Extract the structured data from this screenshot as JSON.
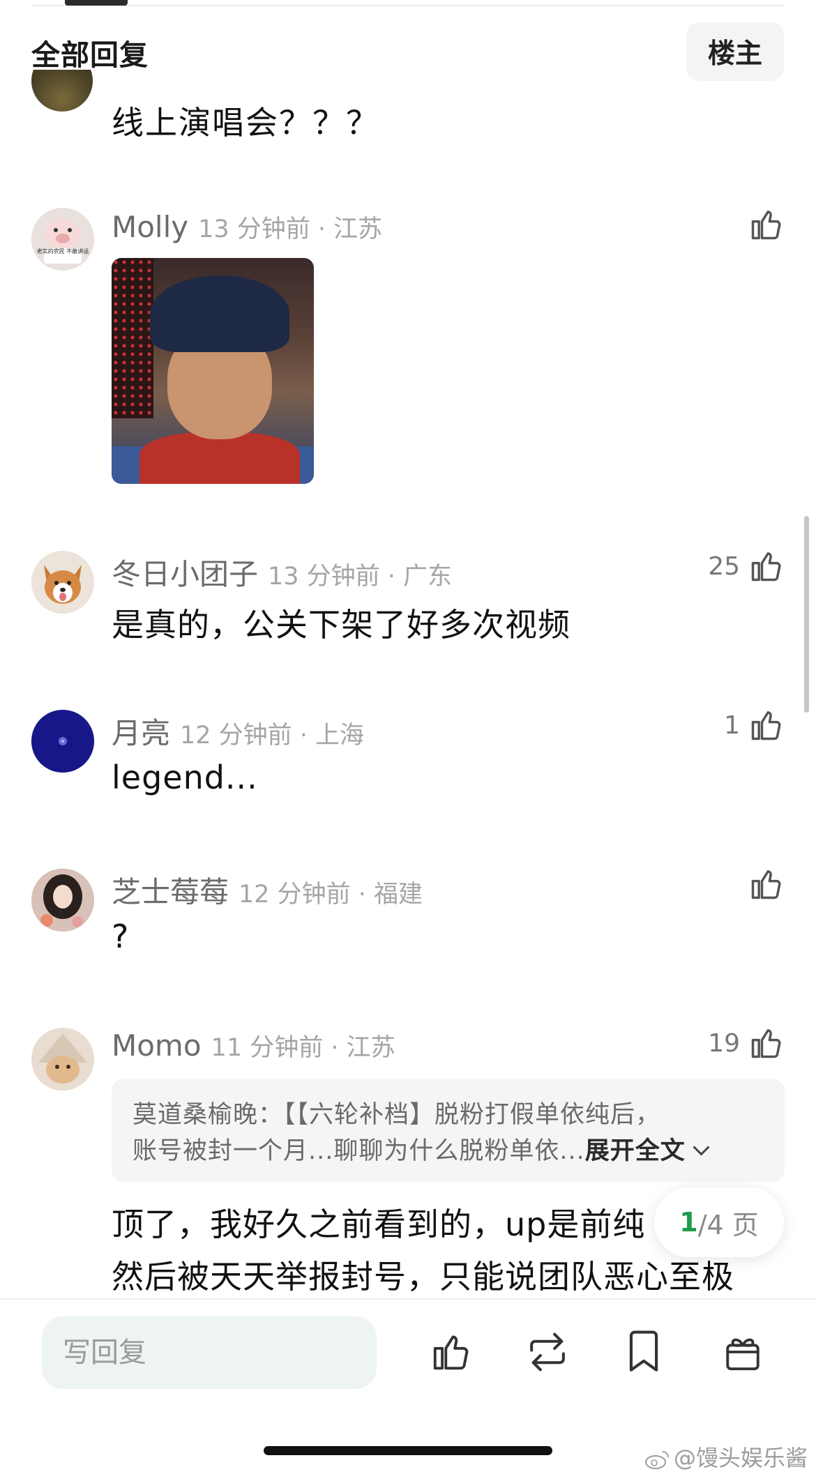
{
  "header": {
    "section_title": "全部回复",
    "op_button": "楼主"
  },
  "comments": [
    {
      "text": "线上演唱会？？？"
    },
    {
      "name": "Molly",
      "time_location": "13 分钟前 · 江苏",
      "likes": "",
      "avatar_caption": "老实的农民 不敢讲话",
      "has_image": true
    },
    {
      "name": "冬日小团子",
      "time_location": "13 分钟前 · 广东",
      "likes": "25",
      "text": "是真的，公关下架了好多次视频"
    },
    {
      "name": "月亮",
      "time_location": "12 分钟前 · 上海",
      "likes": "1",
      "text": "legend..."
    },
    {
      "name": "芝士莓莓",
      "time_location": "12 分钟前 · 福建",
      "likes": "",
      "text": "?"
    },
    {
      "name": "Momo",
      "time_location": "11 分钟前 · 江苏",
      "likes": "19",
      "quote": {
        "line1": "莫道桑榆晚：【【六轮补档】脱粉打假单依纯后，",
        "line2": "账号被封一个月...聊聊为什么脱粉单依...",
        "expand": "展开全文"
      },
      "text_line1": "顶了，我好久之前看到的，up是前纯",
      "text_line2": "然后被天天举报封号，只能说团队恶心至极"
    }
  ],
  "pagination": {
    "current": "1",
    "total_text": "/4 页"
  },
  "bottom_bar": {
    "reply_placeholder": "写回复",
    "icons": [
      "like-icon",
      "repost-icon",
      "bookmark-icon",
      "gift-icon"
    ]
  },
  "watermark": "@馒头娱乐酱",
  "colors": {
    "accent_green": "#1f9c4e",
    "input_bg": "#eef4f0"
  }
}
